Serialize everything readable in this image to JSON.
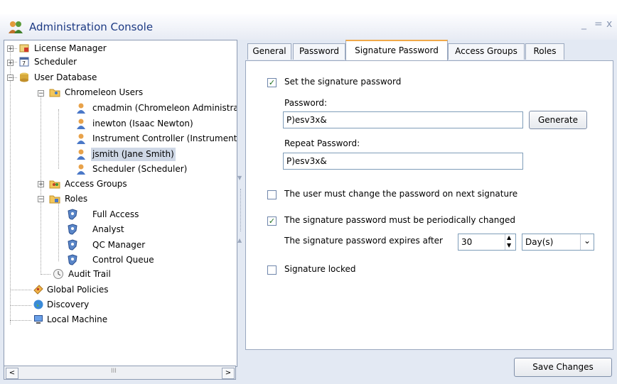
{
  "window": {
    "title": "Administration Console",
    "controls": [
      "_",
      "=",
      "x"
    ]
  },
  "tree": {
    "nodes": [
      {
        "label": "License Manager",
        "icon": "license-icon"
      },
      {
        "label": "Scheduler",
        "icon": "calendar-icon"
      },
      {
        "label": "User Database",
        "icon": "database-icon"
      },
      {
        "label": "Chromeleon Users",
        "icon": "folder-users-icon"
      },
      {
        "label": "cmadmin (Chromeleon Administra",
        "icon": "user-icon"
      },
      {
        "label": "inewton (Isaac Newton)",
        "icon": "user-icon"
      },
      {
        "label": "Instrument Controller (Instrument",
        "icon": "user-icon"
      },
      {
        "label": "jsmith (Jane Smith)",
        "icon": "user-icon"
      },
      {
        "label": "Scheduler (Scheduler)",
        "icon": "user-icon"
      },
      {
        "label": "Access Groups",
        "icon": "folder-group-icon"
      },
      {
        "label": "Roles",
        "icon": "folder-roles-icon"
      },
      {
        "label": "Full Access",
        "icon": "role-shield-icon"
      },
      {
        "label": "Analyst",
        "icon": "role-shield-icon"
      },
      {
        "label": "QC Manager",
        "icon": "role-shield-icon"
      },
      {
        "label": "Control Queue",
        "icon": "role-shield-icon"
      },
      {
        "label": "Audit Trail",
        "icon": "clock-icon"
      },
      {
        "label": "Global Policies",
        "icon": "policy-icon"
      },
      {
        "label": "Discovery",
        "icon": "globe-icon"
      },
      {
        "label": "Local Machine",
        "icon": "computer-icon"
      }
    ],
    "expanders": [
      "+",
      "+",
      "−",
      "−",
      "+",
      "−"
    ],
    "selected": "jsmith (Jane Smith)",
    "scroll_grip": "III"
  },
  "tabs": [
    "General",
    "Password",
    "Signature Password",
    "Access Groups",
    "Roles"
  ],
  "active_tab": "Signature Password",
  "form": {
    "set_signature_password": {
      "label": "Set the signature password",
      "checked": true
    },
    "password_label": "Password:",
    "password_value": "P)esv3x&",
    "generate_label": "Generate",
    "repeat_label": "Repeat Password:",
    "repeat_value": "P)esv3x&",
    "must_change": {
      "label": "The user must change the password on next signature",
      "checked": false
    },
    "periodic_change": {
      "label": "The signature password must be periodically changed",
      "checked": true
    },
    "expires_label": "The signature password expires after",
    "expires_value": "30",
    "unit_value": "Day(s)",
    "locked": {
      "label": "Signature locked",
      "checked": false
    }
  },
  "save_label": "Save Changes",
  "glyphs": {
    "check": "✓",
    "up": "▲",
    "down": "▼",
    "left": "<",
    "right": ">",
    "dropdown": "⌄"
  },
  "colors": {
    "title_text": "#1e3b84",
    "active_tab_accent": "#f0a94a",
    "selection": "#cfd8e6",
    "frame": "#e3e9f3"
  }
}
